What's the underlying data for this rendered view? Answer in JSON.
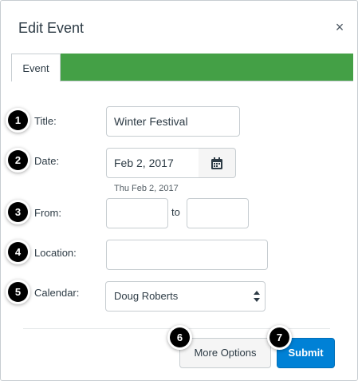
{
  "dialog": {
    "title": "Edit Event",
    "close_glyph": "×",
    "tab_label": "Event",
    "tab_accent_color": "#44a046"
  },
  "badges": [
    "1",
    "2",
    "3",
    "4",
    "5",
    "6",
    "7"
  ],
  "form": {
    "title_label": "Title:",
    "title_value": "Winter Festival",
    "date_label": "Date:",
    "date_value": "Feb 2, 2017",
    "date_hint": "Thu Feb 2, 2017",
    "from_label": "From:",
    "from_value": "",
    "to_label": "to",
    "to_value": "",
    "location_label": "Location:",
    "location_value": "",
    "calendar_label": "Calendar:",
    "calendar_selected": "Doug Roberts"
  },
  "icons": {
    "calendar": "calendar-icon",
    "close": "close-icon",
    "select": "select-arrows-icon"
  },
  "actions": {
    "more_options_label": "More Options",
    "submit_label": "Submit",
    "submit_color": "#0081d6"
  }
}
